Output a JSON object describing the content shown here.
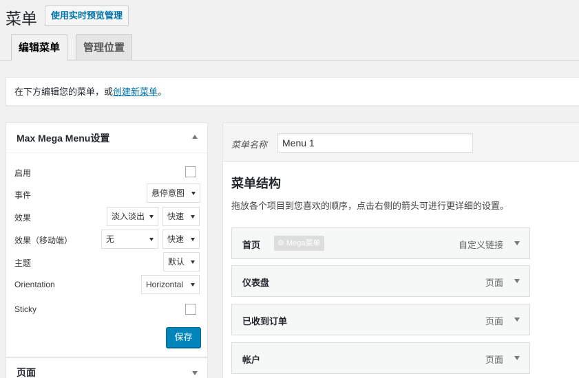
{
  "header": {
    "title": "菜单",
    "action_label": "使用实时预览管理"
  },
  "tabs": [
    {
      "label": "编辑菜单",
      "active": true
    },
    {
      "label": "管理位置",
      "active": false
    }
  ],
  "notice": {
    "prefix": "在下方编辑您的菜单，或",
    "link": "创建新菜单",
    "suffix": "。"
  },
  "settings": {
    "title": "Max Mega Menu设置",
    "labels": {
      "enabled": "启用",
      "event": "事件",
      "effect": "效果",
      "effect_mobile": "效果（移动端）",
      "theme": "主题",
      "orientation": "Orientation",
      "sticky": "Sticky"
    },
    "values": {
      "event": "悬停意图",
      "effect": "淡入淡出",
      "effect_speed": "快速",
      "effect_mobile": "无",
      "effect_mobile_speed": "快速",
      "theme": "默认",
      "orientation": "Horizontal"
    },
    "save_label": "保存"
  },
  "pages_panel": {
    "title": "页面"
  },
  "menu": {
    "name_label": "菜单名称",
    "name_value": "Menu 1",
    "structure_title": "菜单结构",
    "structure_desc": "拖放各个项目到您喜欢的顺序，点击右侧的箭头可进行更详细的设置。",
    "mega_badge": "Mega菜单",
    "items": [
      {
        "title": "首页",
        "type": "自定义链接"
      },
      {
        "title": "仪表盘",
        "type": "页面"
      },
      {
        "title": "已收到订单",
        "type": "页面"
      },
      {
        "title": "帐户",
        "type": "页面"
      }
    ]
  },
  "colors": {
    "accent": "#0073aa",
    "primary_button": "#0085ba"
  }
}
